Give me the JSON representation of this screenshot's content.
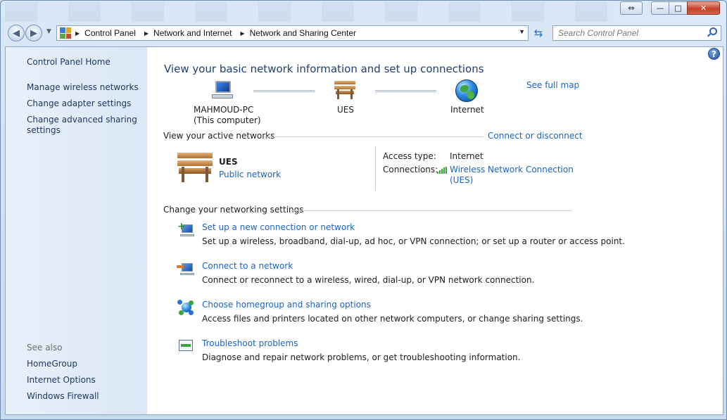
{
  "window": {
    "caption": {
      "restore_label": "⇔",
      "minimize_label": "—",
      "maximize_label": "□",
      "close_label": "✕"
    }
  },
  "navbar": {
    "breadcrumbs": [
      "Control Panel",
      "Network and Internet",
      "Network and Sharing Center"
    ],
    "search_placeholder": "Search Control Panel"
  },
  "sidebar": {
    "home": "Control Panel Home",
    "links": [
      "Manage wireless networks",
      "Change adapter settings",
      "Change advanced sharing",
      "settings"
    ],
    "see_also_label": "See also",
    "see_also": [
      "HomeGroup",
      "Internet Options",
      "Windows Firewall"
    ]
  },
  "main": {
    "title": "View your basic network information and set up connections",
    "see_full_map": "See full map",
    "map": {
      "computer_name": "MAHMOUD-PC",
      "computer_sub": "(This computer)",
      "network_name": "UES",
      "internet": "Internet"
    },
    "active_networks": {
      "heading": "View your active networks",
      "connect_link": "Connect or disconnect",
      "network_name": "UES",
      "network_type": "Public network",
      "access_type_label": "Access type:",
      "access_type_value": "Internet",
      "connections_label": "Connections:",
      "connection_line1": "Wireless Network Connection",
      "connection_line2": "(UES)"
    },
    "settings": {
      "heading": "Change your networking settings",
      "tasks": [
        {
          "link": "Set up a new connection or network",
          "desc": "Set up a wireless, broadband, dial-up, ad hoc, or VPN connection; or set up a router or access point.",
          "icon": "new-connection-icon"
        },
        {
          "link": "Connect to a network",
          "desc": "Connect or reconnect to a wireless, wired, dial-up, or VPN network connection.",
          "icon": "connect-network-icon"
        },
        {
          "link": "Choose homegroup and sharing options",
          "desc": "Access files and printers located on other network computers, or change sharing settings.",
          "icon": "homegroup-icon"
        },
        {
          "link": "Troubleshoot problems",
          "desc": "Diagnose and repair network problems, or get troubleshooting information.",
          "icon": "troubleshoot-icon"
        }
      ]
    }
  },
  "colors": {
    "link": "#1b64c1",
    "title": "#1e3f75",
    "sidebar_text": "#1b365f"
  }
}
